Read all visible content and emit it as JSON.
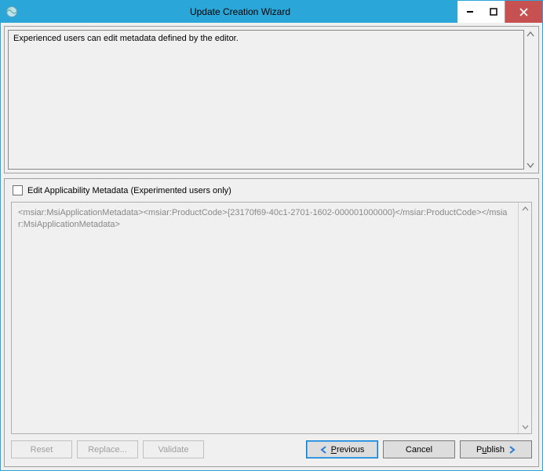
{
  "window": {
    "title": "Update Creation Wizard"
  },
  "top_panel": {
    "description": "Experienced users can edit metadata defined by the editor."
  },
  "bottom_panel": {
    "checkbox_label": "Edit Applicability Metadata (Experimented users only)",
    "xml_content": "<msiar:MsiApplicationMetadata><msiar:ProductCode>{23170f69-40c1-2701-1602-000001000000}</msiar:ProductCode></msiar:MsiApplicationMetadata>"
  },
  "buttons": {
    "reset": "Reset",
    "replace": "Replace...",
    "validate": "Validate",
    "previous": "Previous",
    "cancel": "Cancel",
    "publish": "Publish"
  }
}
